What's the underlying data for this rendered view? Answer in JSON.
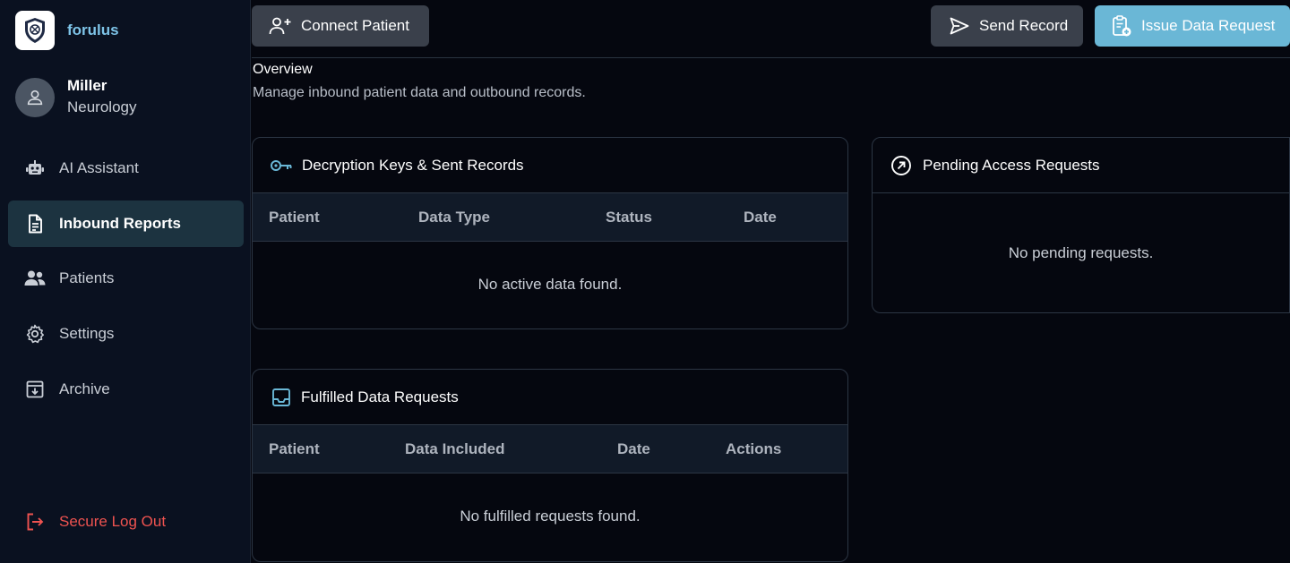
{
  "brand": {
    "name": "forulus"
  },
  "user": {
    "name": "Miller",
    "department": "Neurology"
  },
  "nav": [
    {
      "label": "AI Assistant",
      "icon": "robot-icon"
    },
    {
      "label": "Inbound Reports",
      "icon": "document-icon",
      "active": true
    },
    {
      "label": "Patients",
      "icon": "users-icon"
    },
    {
      "label": "Settings",
      "icon": "gear-icon"
    },
    {
      "label": "Archive",
      "icon": "archive-icon"
    }
  ],
  "logout": {
    "label": "Secure Log Out"
  },
  "toolbar": {
    "connect_label": "Connect Patient",
    "send_label": "Send Record",
    "issue_label": "Issue Data Request"
  },
  "overview": {
    "title": "Overview",
    "subtitle": "Manage inbound patient data and outbound records."
  },
  "keys_card": {
    "title": "Decryption Keys & Sent Records",
    "columns": [
      "Patient",
      "Data Type",
      "Status",
      "Date"
    ],
    "empty": "No active data found."
  },
  "pending_card": {
    "title": "Pending Access Requests",
    "empty": "No pending requests."
  },
  "fulfilled_card": {
    "title": "Fulfilled Data Requests",
    "columns": [
      "Patient",
      "Data Included",
      "Date",
      "Actions"
    ],
    "empty": "No fulfilled requests found."
  },
  "colors": {
    "accent": "#6ab7d6",
    "brand": "#7ec4e8",
    "danger": "#ef5350",
    "active_nav": "#1c3340"
  }
}
